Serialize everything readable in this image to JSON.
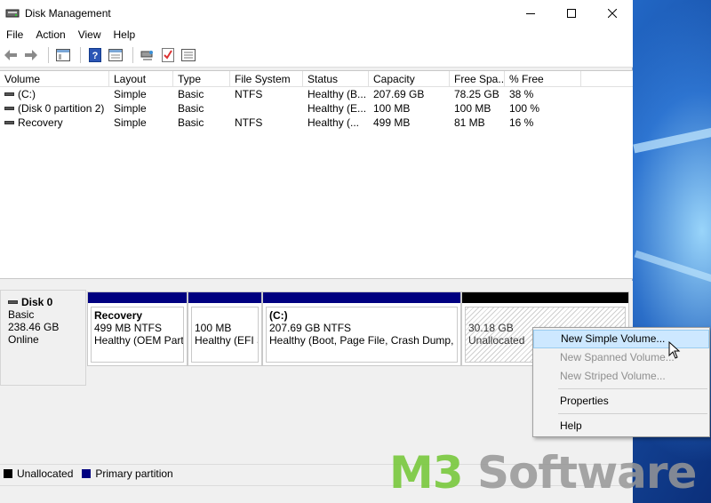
{
  "window": {
    "title": "Disk Management",
    "controls": [
      "minimize-icon",
      "maximize-icon",
      "close-icon"
    ]
  },
  "menubar": {
    "items": [
      "File",
      "Action",
      "View",
      "Help"
    ]
  },
  "toolbar": {
    "icons": [
      "back-arrow-icon",
      "forward-arrow-icon",
      "console-tree-icon",
      "help-icon",
      "properties-icon",
      "connect-icon",
      "check-icon",
      "list-icon"
    ]
  },
  "volume_table": {
    "columns": [
      "Volume",
      "Layout",
      "Type",
      "File System",
      "Status",
      "Capacity",
      "Free Spa...",
      "% Free"
    ],
    "rows": [
      [
        "(C:)",
        "Simple",
        "Basic",
        "NTFS",
        "Healthy (B...",
        "207.69 GB",
        "78.25 GB",
        "38 %"
      ],
      [
        "(Disk 0 partition 2)",
        "Simple",
        "Basic",
        "",
        "Healthy (E...",
        "100 MB",
        "100 MB",
        "100 %"
      ],
      [
        "Recovery",
        "Simple",
        "Basic",
        "NTFS",
        "Healthy (...",
        "499 MB",
        "81 MB",
        "16 %"
      ]
    ]
  },
  "disk": {
    "name": "Disk 0",
    "type": "Basic",
    "size": "238.46 GB",
    "state": "Online",
    "partitions": [
      {
        "name": "Recovery",
        "size": "499 MB NTFS",
        "status": "Healthy (OEM Partit",
        "kind": "primary"
      },
      {
        "name": "",
        "size": "100 MB",
        "status": "Healthy (EFI S",
        "kind": "primary"
      },
      {
        "name": "(C:)",
        "size": "207.69 GB NTFS",
        "status": "Healthy (Boot, Page File, Crash Dump, Pri",
        "kind": "primary"
      },
      {
        "name": "",
        "size": "30.18 GB",
        "status": "Unallocated",
        "kind": "unallocated"
      }
    ]
  },
  "legend": {
    "items": [
      {
        "label": "Unallocated",
        "color": "#000000"
      },
      {
        "label": "Primary partition",
        "color": "#000080"
      }
    ]
  },
  "context_menu": {
    "items": [
      {
        "label": "New Simple Volume...",
        "state": "highlighted"
      },
      {
        "label": "New Spanned Volume...",
        "state": "disabled"
      },
      {
        "label": "New Striped Volume...",
        "state": "disabled"
      },
      {
        "label": "Properties",
        "state": "enabled"
      },
      {
        "label": "Help",
        "state": "enabled"
      }
    ]
  },
  "watermark": {
    "part1": "M3",
    "part2": " Software"
  },
  "colors": {
    "primary_partition": "#000080",
    "unallocated": "#000000",
    "menu_highlight": "#cde8ff"
  }
}
